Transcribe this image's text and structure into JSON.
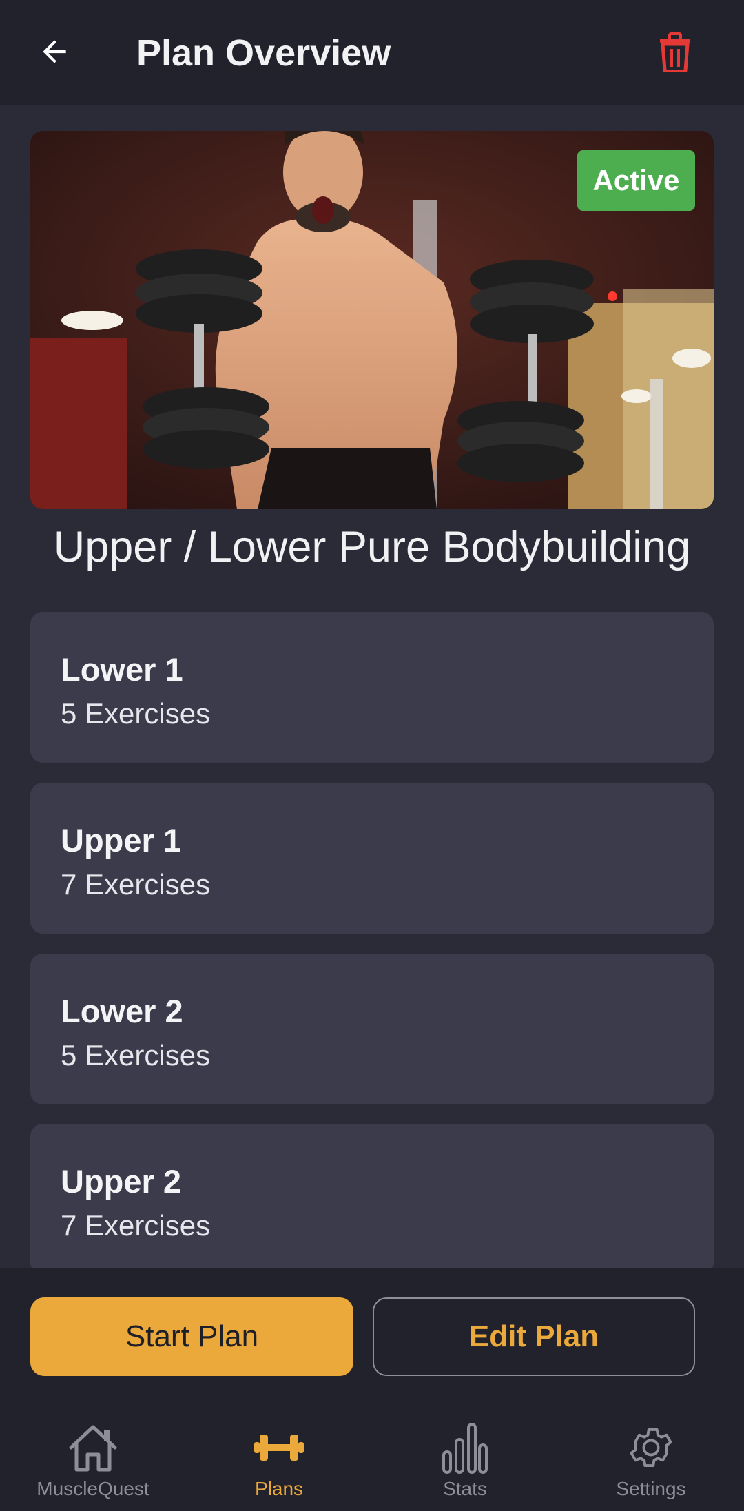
{
  "header": {
    "title": "Plan Overview",
    "back_icon": "arrow-left-icon",
    "delete_icon": "trash-icon",
    "delete_color": "#e53935"
  },
  "hero": {
    "image_desc_icon": "hero-photo",
    "status_badge": "Active",
    "status_color": "#4cae4f"
  },
  "plan": {
    "name": "Upper / Lower Pure Bodybuilding"
  },
  "workouts": [
    {
      "title": "Lower 1",
      "subtitle": "5 Exercises"
    },
    {
      "title": "Upper 1",
      "subtitle": "7 Exercises"
    },
    {
      "title": "Lower 2",
      "subtitle": "5 Exercises"
    },
    {
      "title": "Upper 2",
      "subtitle": "7 Exercises"
    }
  ],
  "actions": {
    "start_label": "Start Plan",
    "edit_label": "Edit Plan",
    "accent": "#eba93b"
  },
  "nav": {
    "items": [
      {
        "label": "MuscleQuest",
        "icon": "home-icon",
        "active": false
      },
      {
        "label": "Plans",
        "icon": "dumbbell-icon",
        "active": true
      },
      {
        "label": "Stats",
        "icon": "bar-chart-icon",
        "active": false
      },
      {
        "label": "Settings",
        "icon": "gear-icon",
        "active": false
      }
    ]
  }
}
